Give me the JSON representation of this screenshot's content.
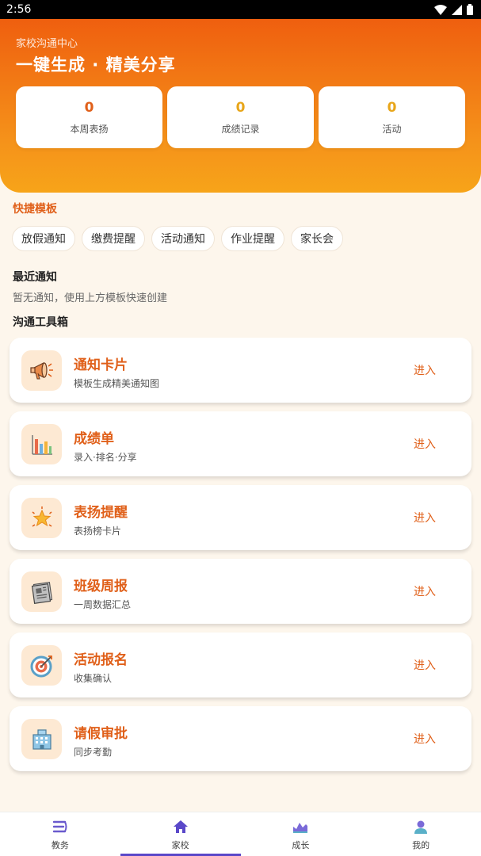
{
  "status_bar": {
    "time": "2:56"
  },
  "header": {
    "subtitle": "家校沟通中心",
    "title": "一键生成 · 精美分享",
    "stats": [
      {
        "value": "0",
        "label": "本周表扬",
        "color": "#e0601a"
      },
      {
        "value": "0",
        "label": "成绩记录",
        "color": "#e8a61a"
      },
      {
        "value": "0",
        "label": "活动",
        "color": "#e8a61a"
      }
    ]
  },
  "quick_templates": {
    "title": "快捷模板",
    "items": [
      "放假通知",
      "缴费提醒",
      "活动通知",
      "作业提醒",
      "家长会"
    ]
  },
  "recent": {
    "title": "最近通知",
    "empty_text": "暂无通知，使用上方模板快速创建"
  },
  "toolbox": {
    "title": "沟通工具箱",
    "enter_label": "进入",
    "tools": [
      {
        "title": "通知卡片",
        "desc": "模板生成精美通知图",
        "icon": "megaphone-icon"
      },
      {
        "title": "成绩单",
        "desc": "录入·排名·分享",
        "icon": "bar-chart-icon"
      },
      {
        "title": "表扬提醒",
        "desc": "表扬榜卡片",
        "icon": "star-icon"
      },
      {
        "title": "班级周报",
        "desc": "一周数据汇总",
        "icon": "newspaper-icon"
      },
      {
        "title": "活动报名",
        "desc": "收集确认",
        "icon": "target-icon"
      },
      {
        "title": "请假审批",
        "desc": "同步考勤",
        "icon": "building-icon"
      }
    ]
  },
  "bottom_nav": {
    "items": [
      {
        "label": "教务",
        "icon": "list-icon"
      },
      {
        "label": "家校",
        "icon": "home-icon",
        "active": true
      },
      {
        "label": "成长",
        "icon": "growth-icon"
      },
      {
        "label": "我的",
        "icon": "user-icon"
      }
    ]
  },
  "colors": {
    "accent": "#e0601a",
    "header_gradient_start": "#ef5f0f",
    "header_gradient_end": "#f7a419",
    "nav_active": "#5a48c9",
    "background": "#fdf6ec"
  }
}
